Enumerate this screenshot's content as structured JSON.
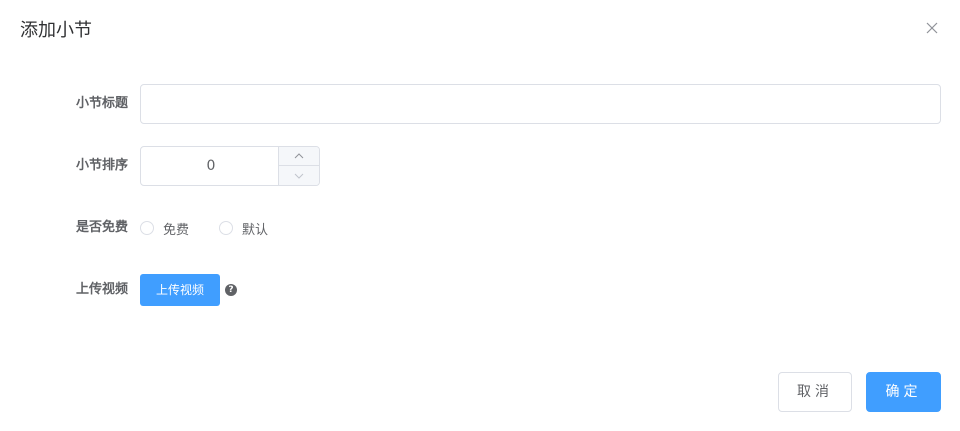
{
  "dialog": {
    "title": "添加小节",
    "close_icon": "close-icon"
  },
  "form": {
    "title_field": {
      "label": "小节标题",
      "value": "",
      "placeholder": ""
    },
    "sort_field": {
      "label": "小节排序",
      "value": "0",
      "increase_icon": "chevron-up-icon",
      "decrease_icon": "chevron-down-icon"
    },
    "free_field": {
      "label": "是否免费",
      "options": [
        "免费",
        "默认"
      ]
    },
    "video_field": {
      "label": "上传视频",
      "button_label": "上传视频",
      "help_icon": "question-circle-icon",
      "help_glyph": "?"
    }
  },
  "footer": {
    "cancel_label": "取消",
    "confirm_label": "确定"
  },
  "colors": {
    "primary": "#409eff",
    "border": "#dcdfe6",
    "text": "#606266",
    "title": "#303133"
  }
}
